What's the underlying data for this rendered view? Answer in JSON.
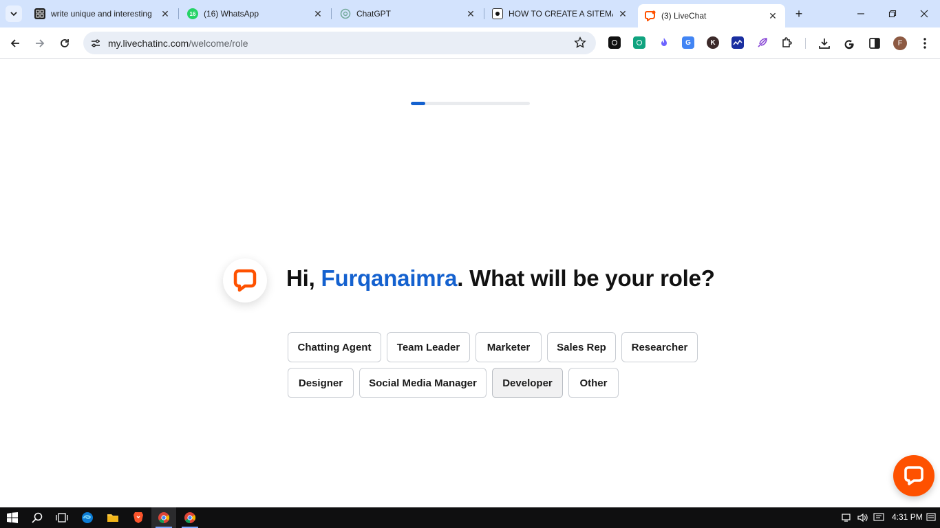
{
  "browser": {
    "tabs": [
      {
        "title": "write unique and interesting",
        "favicon": "grid-logo-icon",
        "active": false
      },
      {
        "title": "(16) WhatsApp",
        "favicon": "whatsapp-icon",
        "badge": "16",
        "active": false
      },
      {
        "title": "ChatGPT",
        "favicon": "chatgpt-icon",
        "active": false
      },
      {
        "title": "HOW TO CREATE A SITEMAP",
        "favicon": "document-icon",
        "active": false
      },
      {
        "title": "(3) LiveChat",
        "favicon": "livechat-icon",
        "active": true
      }
    ],
    "address": {
      "domain": "my.livechatinc.com",
      "path": "/welcome/role"
    },
    "profile_initial": "F",
    "extension_k_label": "K"
  },
  "page": {
    "progress_fraction": 0.12,
    "greeting_prefix": "Hi, ",
    "user_name": "Furqanaimra",
    "greeting_suffix": ". What will be your role?",
    "roles": [
      "Chatting Agent",
      "Team Leader",
      "Marketer",
      "Sales Rep",
      "Researcher",
      "Designer",
      "Social Media Manager",
      "Developer",
      "Other"
    ]
  },
  "taskbar": {
    "time": "4:31 PM"
  },
  "colors": {
    "accent_blue": "#1461cf",
    "livechat_orange": "#fe5100",
    "tabstrip_bg": "#d3e3fd"
  }
}
